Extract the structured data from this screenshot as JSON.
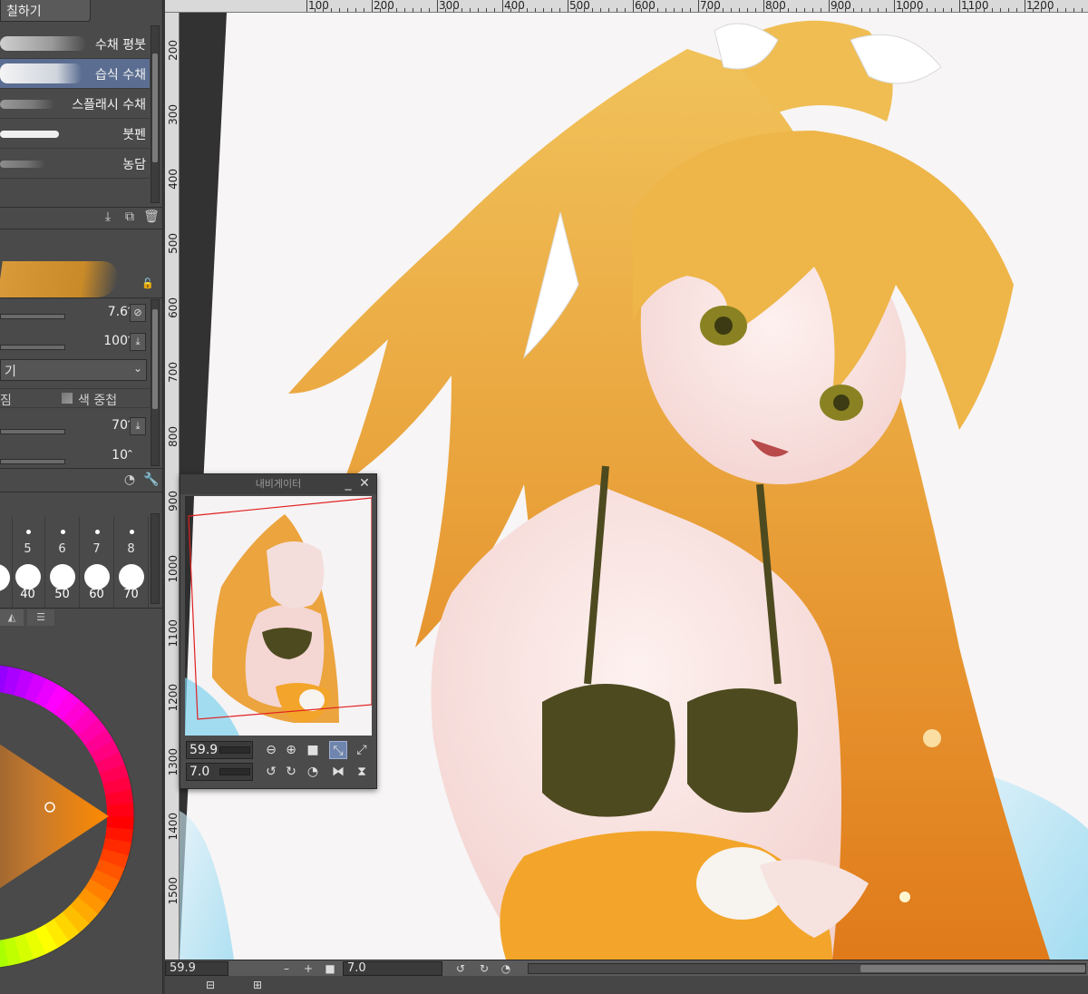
{
  "left_panel": {
    "top_tab": "칠하기",
    "brushes": [
      {
        "label": "수채 평붓",
        "selected": false
      },
      {
        "label": "습식 수채",
        "selected": true
      },
      {
        "label": "스플래시 수채",
        "selected": false
      },
      {
        "label": "붓펜",
        "selected": false
      },
      {
        "label": "농담",
        "selected": false
      }
    ],
    "params": [
      {
        "value": "7.6"
      },
      {
        "value": "100"
      },
      {
        "value": "70"
      },
      {
        "value": "10"
      }
    ],
    "dropdown_value": "기",
    "blend_label": "짐",
    "color_mix_label": "색 중첩",
    "size_presets": [
      {
        "num": "5",
        "label": "40"
      },
      {
        "num": "6",
        "label": "50"
      },
      {
        "num": "7",
        "label": "60"
      },
      {
        "num": "8",
        "label": "70"
      }
    ],
    "accent_color": "#5b6e92"
  },
  "ruler": {
    "top_labels": [
      "100",
      "200",
      "300",
      "400",
      "500",
      "600",
      "700",
      "800",
      "900",
      "1000",
      "1100",
      "1200"
    ],
    "left_labels": [
      "200",
      "300",
      "400",
      "500",
      "600",
      "700",
      "800",
      "900",
      "1000",
      "1100",
      "1200",
      "1300",
      "1400",
      "1500"
    ]
  },
  "navigator": {
    "title": "내비게이터",
    "zoom": "59.9",
    "rotation": "7.0"
  },
  "bottom_bar": {
    "zoom": "59.9",
    "rotation": "7.0"
  },
  "colors": {
    "panel_bg": "#4a4a4a",
    "selection": "#5b6e92",
    "canvas_bg": "#323232"
  }
}
